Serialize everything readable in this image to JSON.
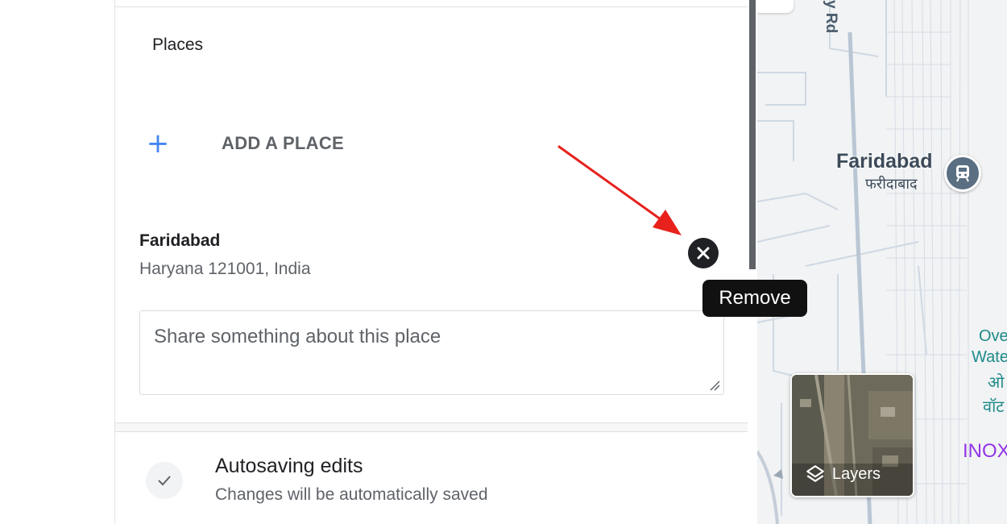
{
  "panel": {
    "section_title": "Places",
    "add_place_label": "ADD A PLACE",
    "place": {
      "name": "Faridabad",
      "address": "Haryana 121001, India"
    },
    "remove_tooltip": "Remove",
    "note_placeholder": "Share something about this place",
    "autosave": {
      "title": "Autosaving edits",
      "subtitle": "Changes will be automatically saved"
    }
  },
  "map": {
    "road_label": "y Rd",
    "city_label": "Faridabad",
    "city_label_hindi": "फरीदाबाद",
    "poi_label_1": "Ove",
    "poi_label_2": "Wate",
    "poi_label_3": "ओ",
    "poi_label_4": "वॉट",
    "poi_label_5": "INOX",
    "layers_label": "Layers"
  },
  "icons": {
    "add": "plus-icon",
    "remove": "close-icon",
    "check": "check-icon",
    "transit": "train-station-icon",
    "layers": "layers-icon",
    "annotation": "red-arrow-annotation"
  },
  "colors": {
    "accent_blue": "#4285f4",
    "annotation_red": "#e8211d",
    "poi_teal": "#1e8a8a",
    "poi_purple": "#9334e6",
    "map_road": "#c9d3df"
  }
}
